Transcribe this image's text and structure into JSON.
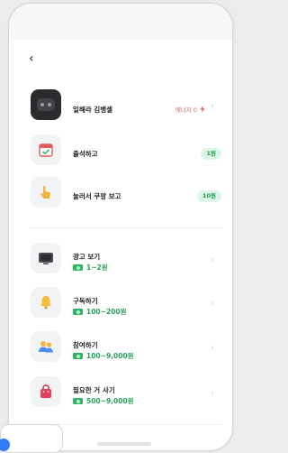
{
  "header": {
    "back_icon": "back-arrow-icon"
  },
  "profile": {
    "name": "일해라 김뱅셀",
    "energy_label": "에너지 0",
    "energy_icon": "lightning-icon"
  },
  "quick_tasks": [
    {
      "title": "출석하고",
      "badge": "1원",
      "icon": "calendar-check-icon"
    },
    {
      "title": "눌러서 쿠팡 보고",
      "badge": "10원",
      "icon": "tap-hand-icon"
    }
  ],
  "missions": [
    {
      "title": "광고 보기",
      "reward": "1~2원",
      "icon": "ad-monitor-icon"
    },
    {
      "title": "구독하기",
      "reward": "100~200원",
      "icon": "bell-icon"
    },
    {
      "title": "참여하기",
      "reward": "100~9,000원",
      "icon": "people-icon"
    },
    {
      "title": "필요한 거 사기",
      "reward": "500~9,000원",
      "icon": "shopping-bag-icon"
    }
  ],
  "colors": {
    "accent_green": "#2aa25a",
    "badge_bg": "#dcf5e6",
    "energy_red": "#e05a5a"
  }
}
